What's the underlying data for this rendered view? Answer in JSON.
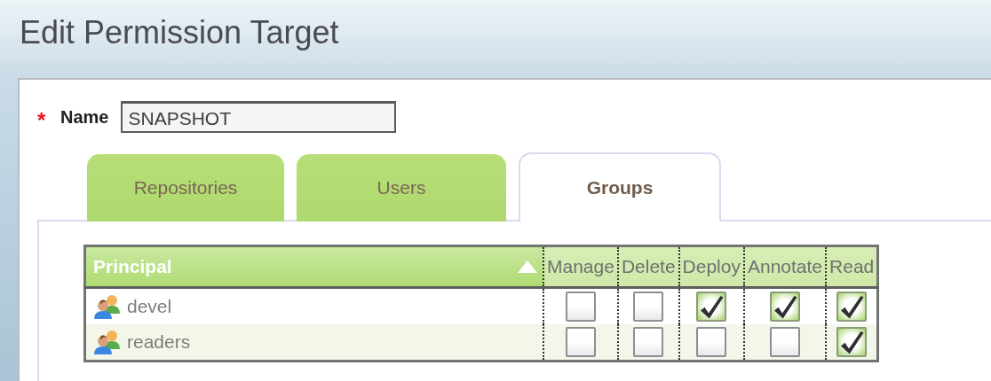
{
  "window": {
    "title": "Edit Permission Target"
  },
  "name_field": {
    "required_mark": "*",
    "label": "Name",
    "value": "SNAPSHOT"
  },
  "tabs": [
    {
      "label": "Repositories",
      "selected": false
    },
    {
      "label": "Users",
      "selected": false
    },
    {
      "label": "Groups",
      "selected": true
    }
  ],
  "table": {
    "columns": [
      {
        "label": "Principal"
      },
      {
        "label": "Manage"
      },
      {
        "label": "Delete"
      },
      {
        "label": "Deploy"
      },
      {
        "label": "Annotate"
      },
      {
        "label": "Read"
      }
    ],
    "rows": [
      {
        "principal": "devel",
        "permissions": [
          {
            "checked": false
          },
          {
            "checked": false
          },
          {
            "checked": true
          },
          {
            "checked": true
          },
          {
            "checked": true
          }
        ]
      },
      {
        "principal": "readers",
        "permissions": [
          {
            "checked": false
          },
          {
            "checked": false
          },
          {
            "checked": false
          },
          {
            "checked": false
          },
          {
            "checked": true
          }
        ]
      }
    ]
  }
}
